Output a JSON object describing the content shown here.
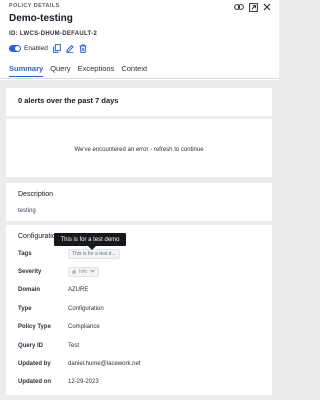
{
  "header": {
    "eyebrow": "POLICY DETAILS",
    "title": "Demo-testing",
    "policy_id": "ID: LWCS-DHUM-DEFAULT-2",
    "enabled_label": "Enabled",
    "icons": [
      "link-icon",
      "open-external-icon",
      "close-icon"
    ],
    "row_icons": [
      "copy-icon",
      "edit-icon",
      "trash-icon"
    ]
  },
  "tabs": [
    "Summary",
    "Query",
    "Exceptions",
    "Context"
  ],
  "alerts": {
    "title": "0 alerts over the past 7 days"
  },
  "error": {
    "message": "We've encountered an error - refresh to continue"
  },
  "description": {
    "title": "Description",
    "text": "testing"
  },
  "configuration": {
    "title": "Configuration",
    "tooltip": "This is for a test demo",
    "rows": [
      {
        "label": "Tags",
        "value": "This is for a test d..."
      },
      {
        "label": "Severity",
        "value": "Info"
      },
      {
        "label": "Domain",
        "value": "AZURE"
      },
      {
        "label": "Type",
        "value": "Configuration"
      },
      {
        "label": "Policy Type",
        "value": "Compliance"
      },
      {
        "label": "Query ID",
        "value": "Test"
      },
      {
        "label": "Updated by",
        "value": "daniel.hume@lacework.net"
      },
      {
        "label": "Updated on",
        "value": "12-29-2023"
      }
    ]
  },
  "colors": {
    "accent": "#2d62d8",
    "background": "#ececed",
    "tooltip": "#17181c"
  }
}
